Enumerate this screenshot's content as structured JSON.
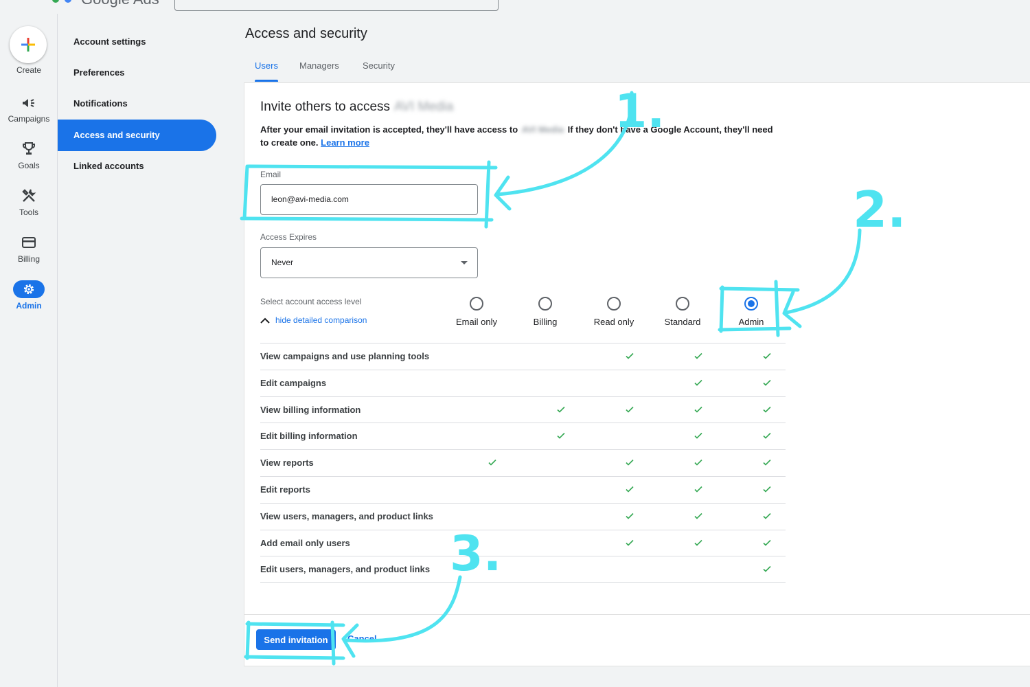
{
  "header": {
    "app_name": "Google Ads"
  },
  "rail": {
    "create_label": "Create",
    "items": [
      {
        "label": "Campaigns",
        "icon": "megaphone-icon"
      },
      {
        "label": "Goals",
        "icon": "trophy-icon"
      },
      {
        "label": "Tools",
        "icon": "tools-icon"
      },
      {
        "label": "Billing",
        "icon": "credit-card-icon"
      },
      {
        "label": "Admin",
        "icon": "gear-icon"
      }
    ]
  },
  "subnav": {
    "items": [
      {
        "label": "Account settings"
      },
      {
        "label": "Preferences"
      },
      {
        "label": "Notifications"
      },
      {
        "label": "Access and security"
      },
      {
        "label": "Linked accounts"
      }
    ]
  },
  "main": {
    "title": "Access and security",
    "tabs": [
      {
        "label": "Users"
      },
      {
        "label": "Managers"
      },
      {
        "label": "Security"
      }
    ]
  },
  "invite": {
    "title": "Invite others to access",
    "account_name": "AVI Media",
    "description_a": "After your email invitation is accepted, they'll have access to",
    "description_b": "If they don't have a Google Account, they'll need to create one.",
    "learn_more": "Learn more",
    "email_label": "Email",
    "email_value": "leon@avi-media.com",
    "expires_label": "Access Expires",
    "expires_value": "Never",
    "level_label": "Select account access level",
    "hide_comparison": "hide detailed comparison",
    "levels": [
      {
        "label": "Email only",
        "checked": false
      },
      {
        "label": "Billing",
        "checked": false
      },
      {
        "label": "Read only",
        "checked": false
      },
      {
        "label": "Standard",
        "checked": false
      },
      {
        "label": "Admin",
        "checked": true
      }
    ],
    "permissions": [
      {
        "name": "View campaigns and use planning tools",
        "access": [
          false,
          false,
          true,
          true,
          true
        ]
      },
      {
        "name": "Edit campaigns",
        "access": [
          false,
          false,
          false,
          true,
          true
        ]
      },
      {
        "name": "View billing information",
        "access": [
          false,
          true,
          true,
          true,
          true
        ]
      },
      {
        "name": "Edit billing information",
        "access": [
          false,
          true,
          false,
          true,
          true
        ]
      },
      {
        "name": "View reports",
        "access": [
          true,
          false,
          true,
          true,
          true
        ]
      },
      {
        "name": "Edit reports",
        "access": [
          false,
          false,
          true,
          true,
          true
        ]
      },
      {
        "name": "View users, managers, and product links",
        "access": [
          false,
          false,
          true,
          true,
          true
        ]
      },
      {
        "name": "Add email only users",
        "access": [
          false,
          false,
          true,
          true,
          true
        ]
      },
      {
        "name": "Edit users, managers, and product links",
        "access": [
          false,
          false,
          false,
          false,
          true
        ]
      }
    ],
    "send_label": "Send invitation",
    "cancel_label": "Cancel"
  },
  "annotations": {
    "step1": "1.",
    "step2": "2.",
    "step3": "3."
  },
  "colors": {
    "accent": "#1a73e8",
    "check": "#34a853",
    "annotation": "#4fe3f0"
  }
}
